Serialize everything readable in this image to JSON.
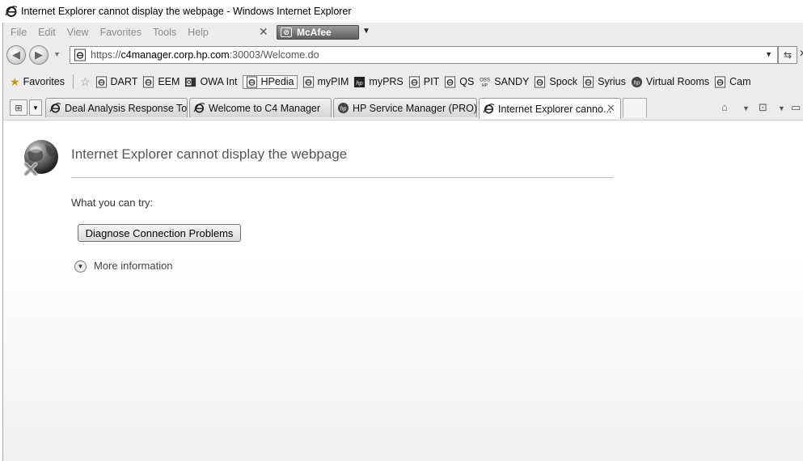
{
  "window": {
    "title": "Internet Explorer cannot display the webpage - Windows Internet Explorer"
  },
  "menu": [
    "File",
    "Edit",
    "View",
    "Favorites",
    "Tools",
    "Help"
  ],
  "toolbar": {
    "mcafee_label": "McAfee"
  },
  "address": {
    "url_prefix": "https://",
    "url_host": "c4manager.corp.hp.com",
    "url_rest": ":30003/Welcome.do"
  },
  "favorites": {
    "label": "Favorites",
    "links": [
      {
        "label": "DART",
        "icon": "ie-page-icon"
      },
      {
        "label": "EEM",
        "icon": "ie-page-icon"
      },
      {
        "label": "OWA Int",
        "icon": "outlook-icon"
      },
      {
        "label": "HPedia",
        "icon": "ie-page-icon"
      },
      {
        "label": "myPIM",
        "icon": "ie-page-icon"
      },
      {
        "label": "myPRS",
        "icon": "hp-logo-icon"
      },
      {
        "label": "PIT",
        "icon": "ie-page-icon"
      },
      {
        "label": "QS",
        "icon": "ie-page-icon"
      },
      {
        "label": "SANDY",
        "icon": "oss-icon"
      },
      {
        "label": "Spock",
        "icon": "ie-page-icon"
      },
      {
        "label": "Syrius",
        "icon": "ie-page-icon"
      },
      {
        "label": "Virtual Rooms",
        "icon": "hp-logo-icon"
      },
      {
        "label": "Cam",
        "icon": "ie-page-icon"
      }
    ]
  },
  "tabs": [
    {
      "label": "Deal Analysis Response Tool"
    },
    {
      "label": "Welcome to C4 Manager"
    },
    {
      "label": "HP Service Manager (PRO)..."
    },
    {
      "label": "Internet Explorer canno..."
    }
  ],
  "error": {
    "title": "Internet Explorer cannot display the webpage",
    "try_label": "What you can try:",
    "diagnose_label": "Diagnose Connection Problems",
    "more_info_label": "More information"
  }
}
